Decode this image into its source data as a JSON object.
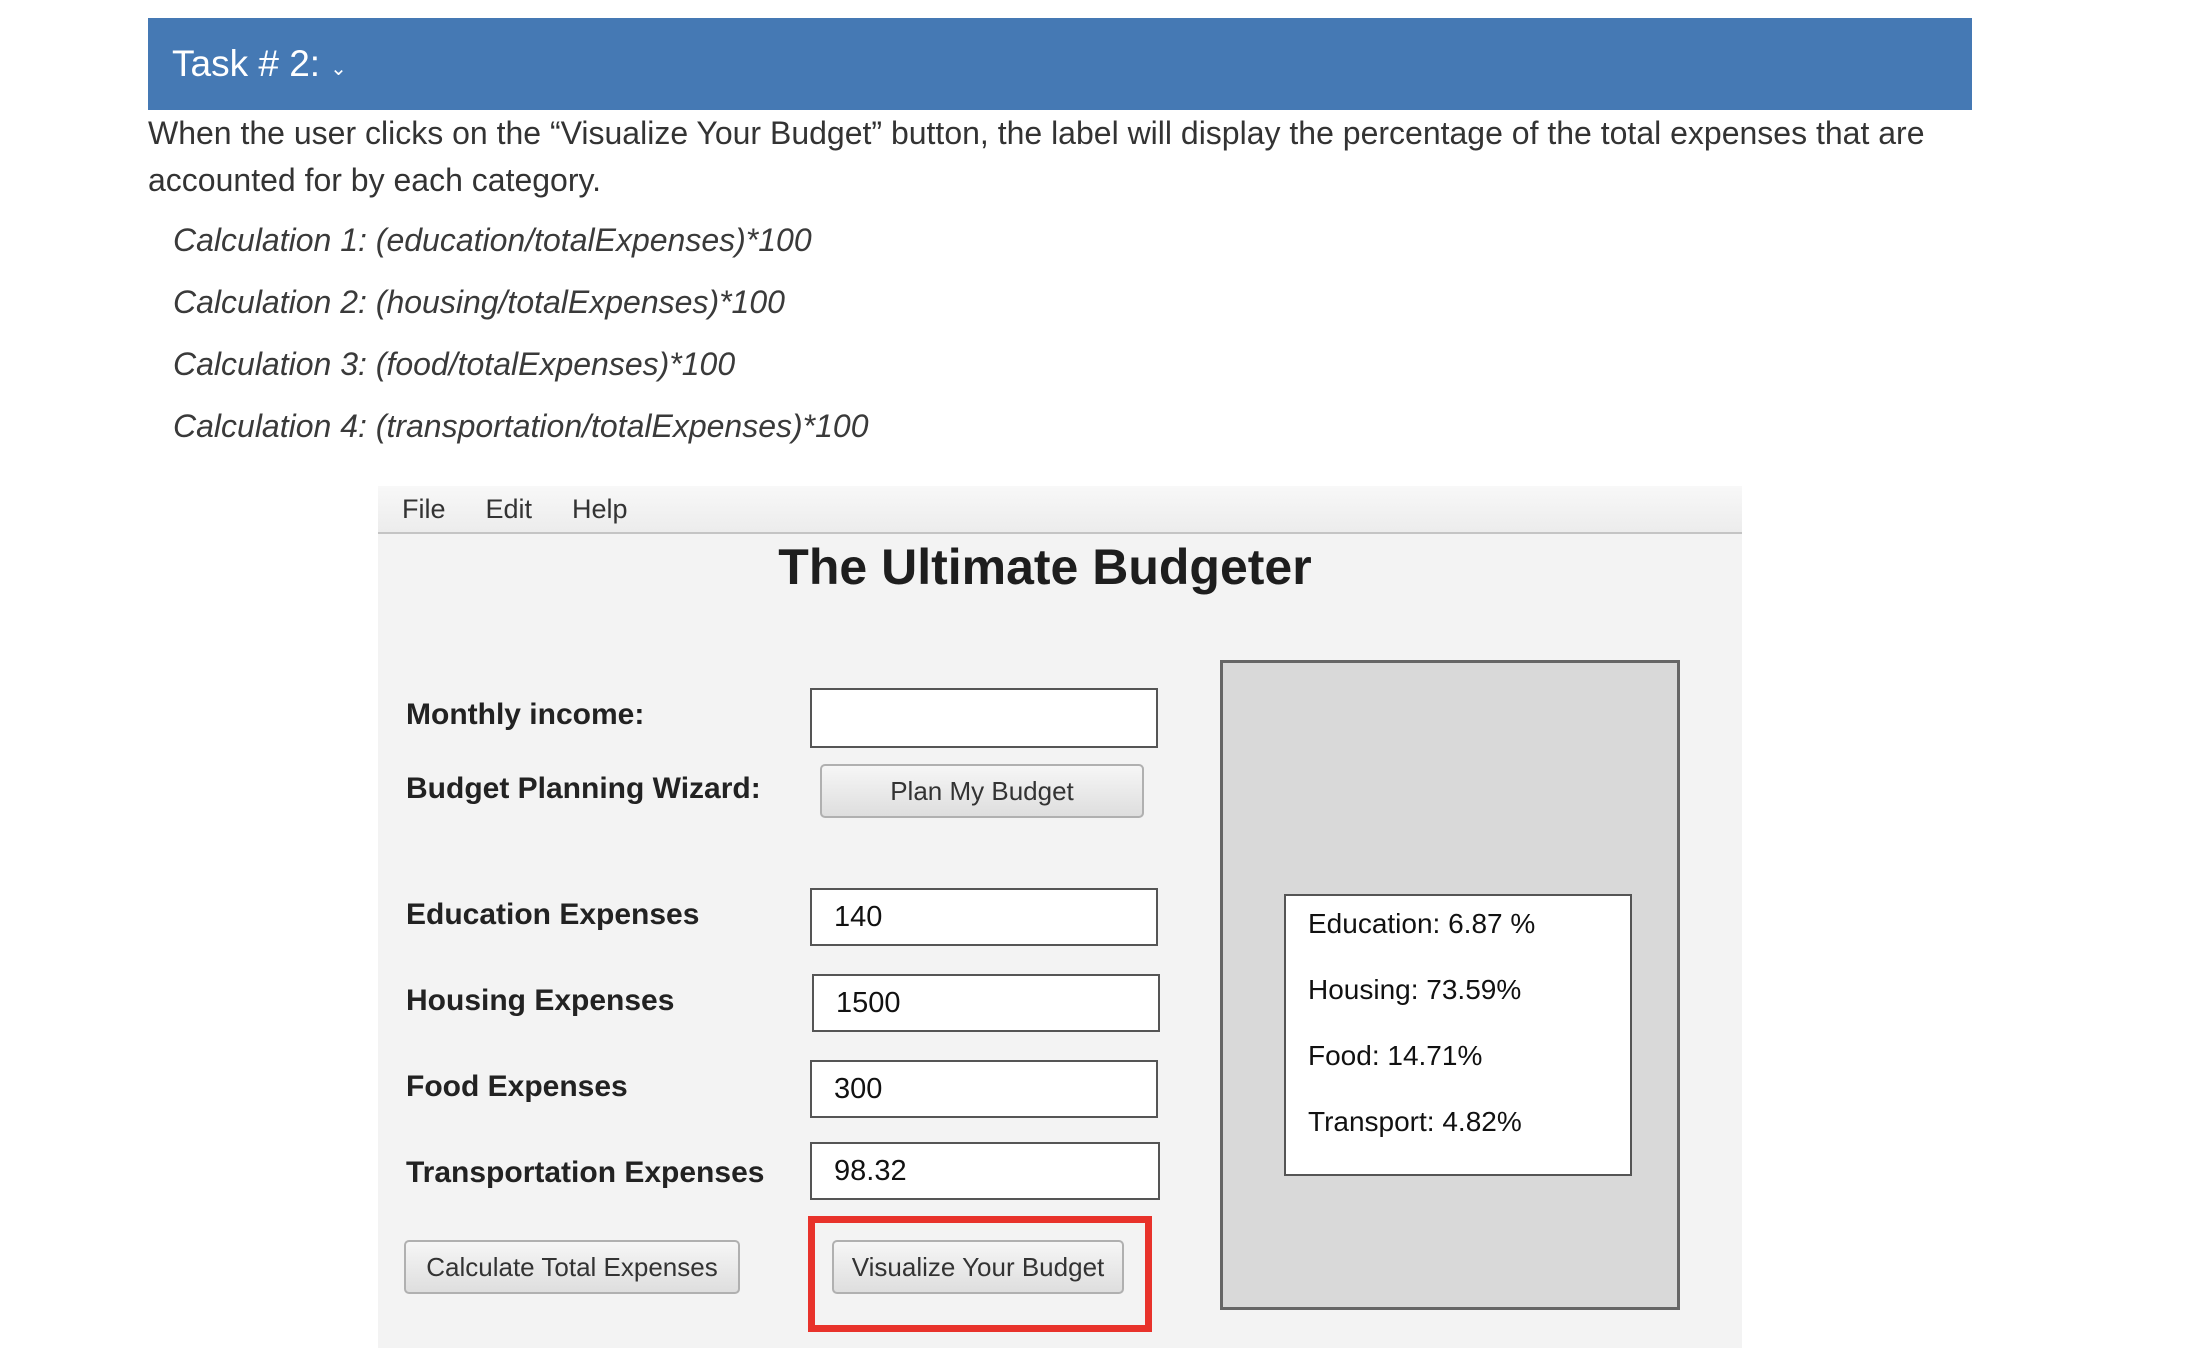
{
  "task": {
    "title": "Task # 2:",
    "caret": "⌄",
    "description": "When the user clicks on the “Visualize Your Budget” button, the label will display the percentage of the total expenses that are accounted for by each category.",
    "calculations": [
      "Calculation 1: (education/totalExpenses)*100",
      "Calculation 2: (housing/totalExpenses)*100",
      "Calculation 3: (food/totalExpenses)*100",
      "Calculation 4: (transportation/totalExpenses)*100"
    ]
  },
  "app": {
    "menu": [
      "File",
      "Edit",
      "Help"
    ],
    "title": "The Ultimate Budgeter",
    "labels": {
      "monthly_income": "Monthly income:",
      "wizard": "Budget Planning Wizard:",
      "education": "Education Expenses",
      "housing": "Housing Expenses",
      "food": "Food Expenses",
      "transportation": "Transportation Expenses"
    },
    "fields": {
      "monthly_income": "",
      "education": "140",
      "housing": "1500",
      "food": "300",
      "transportation": "98.32"
    },
    "buttons": {
      "plan": "Plan My Budget",
      "calculate": "Calculate Total Expenses",
      "visualize": "Visualize Your Budget"
    },
    "results": [
      "Education: 6.87 %",
      "Housing: 73.59%",
      "Food: 14.71%",
      "Transport: 4.82%"
    ],
    "highlight_color": "#e8322b"
  }
}
